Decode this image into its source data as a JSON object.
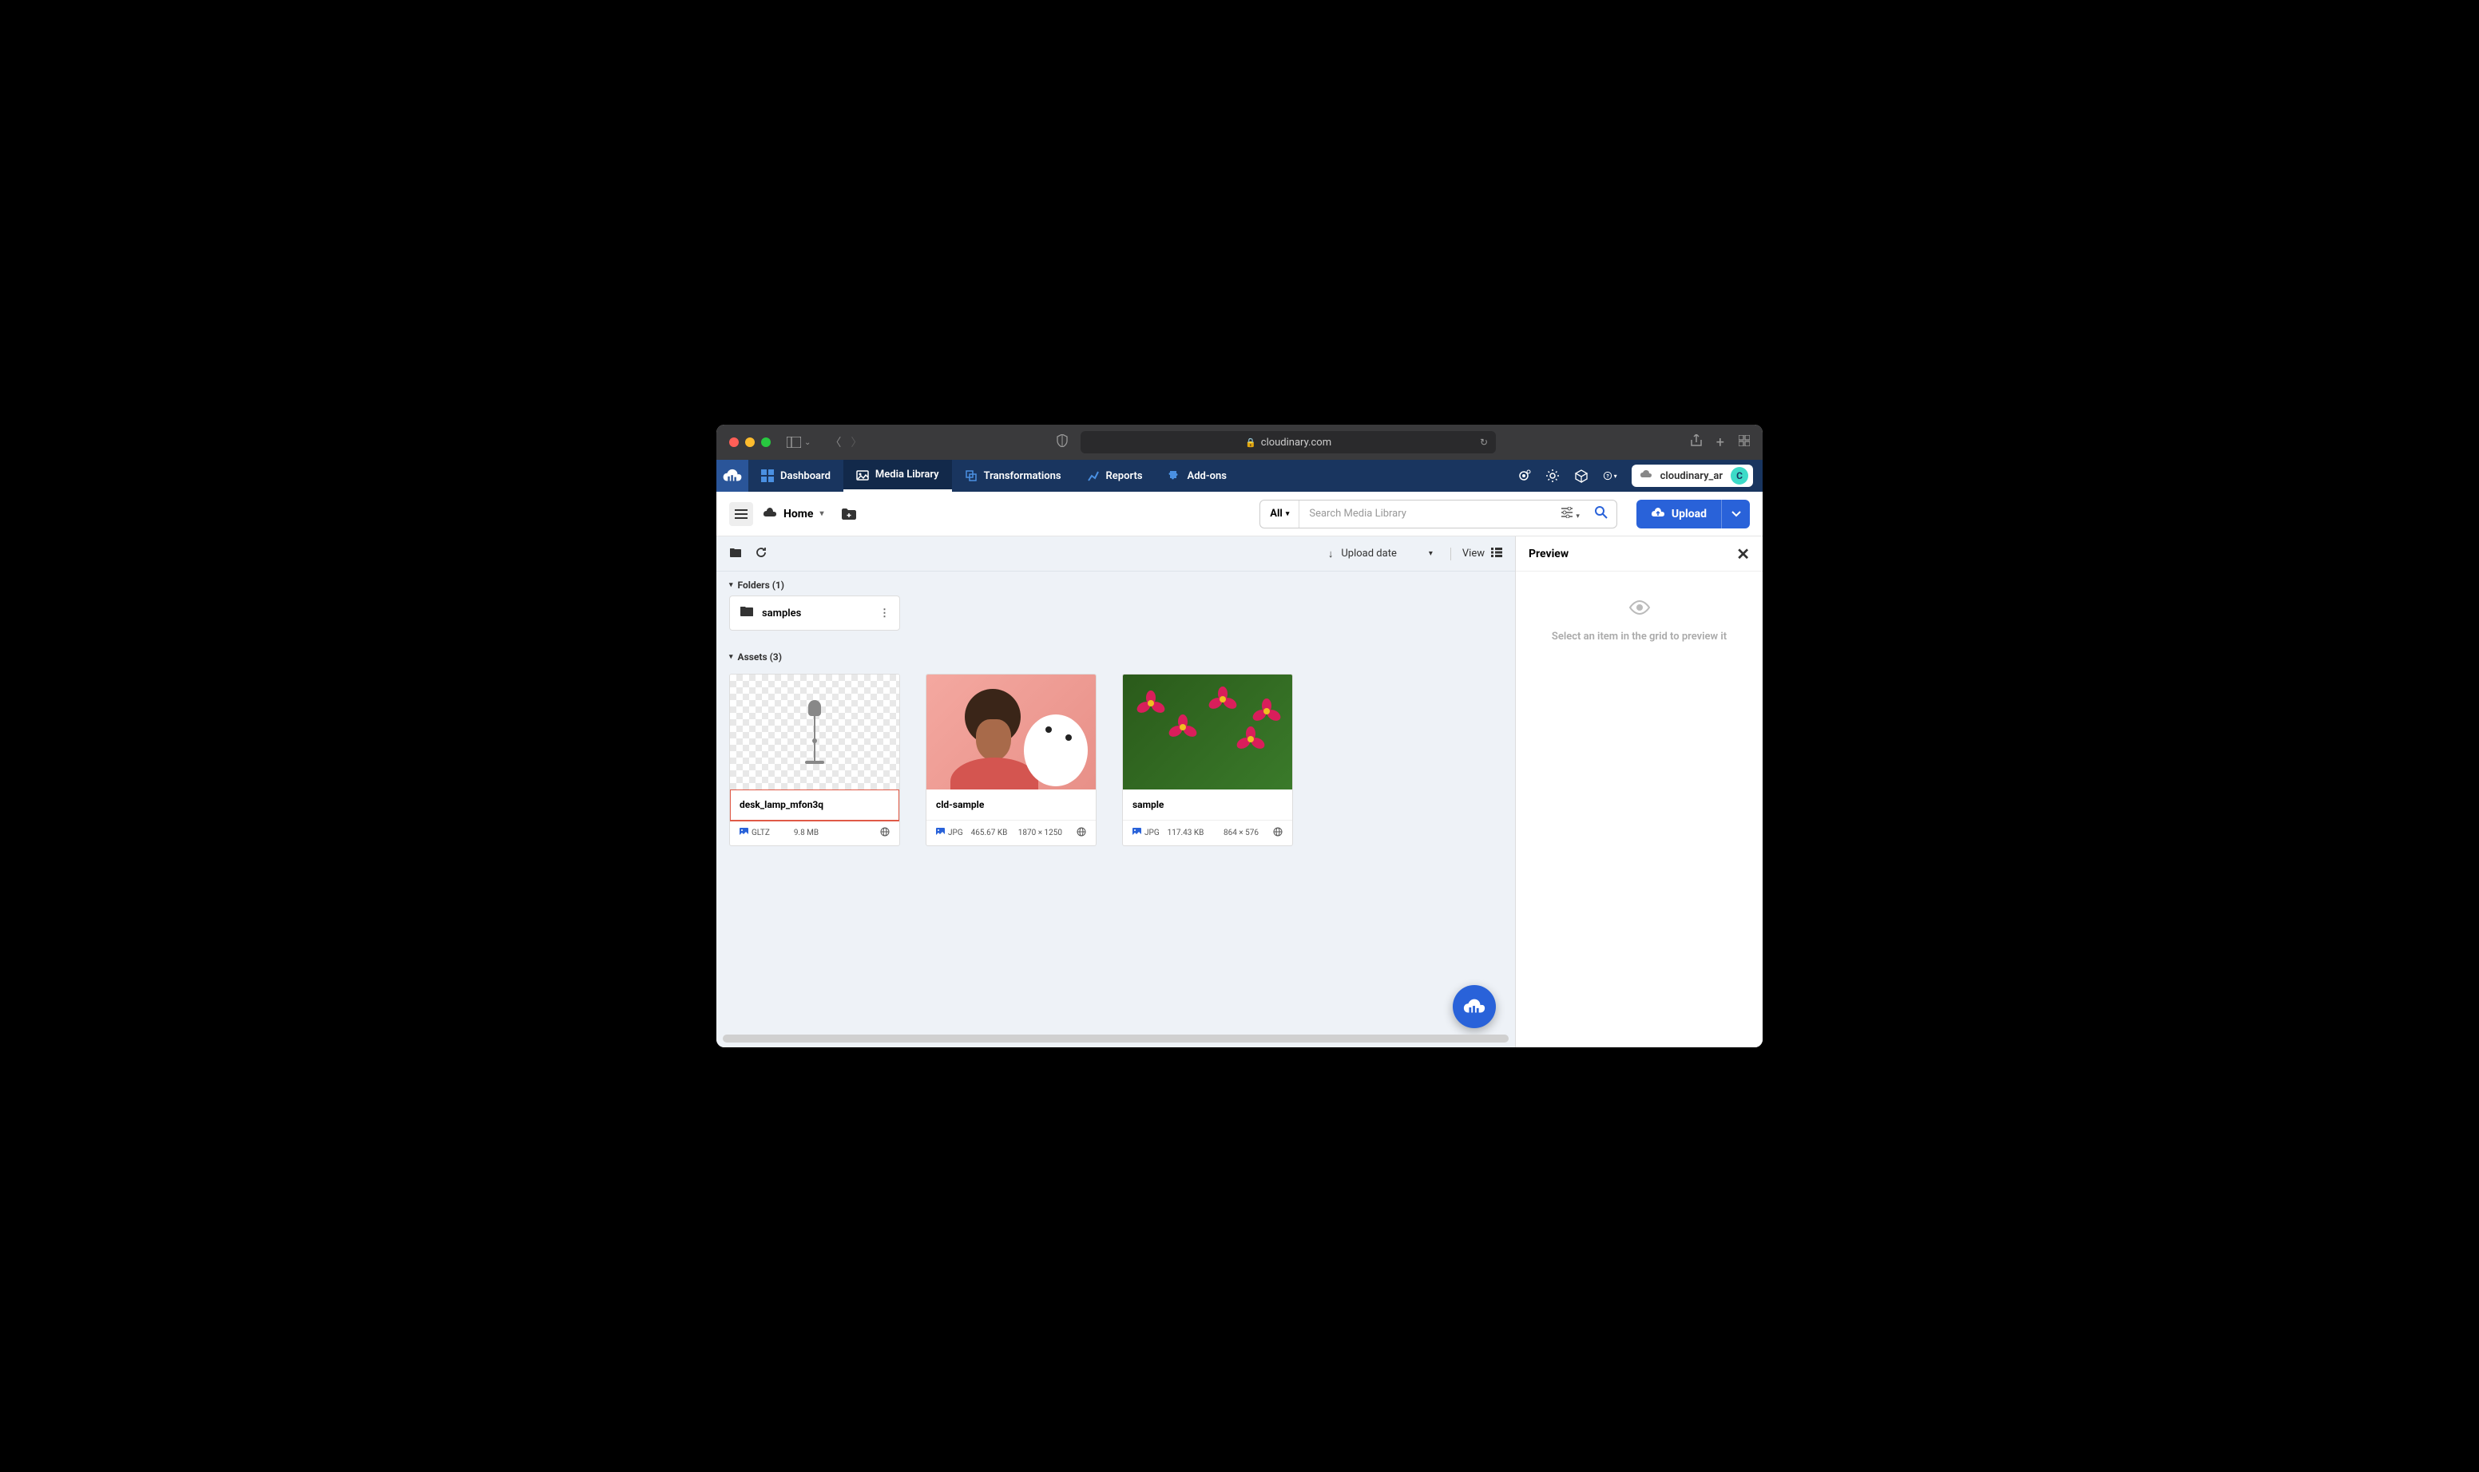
{
  "browser": {
    "url": "cloudinary.com"
  },
  "nav": {
    "items": [
      {
        "label": "Dashboard"
      },
      {
        "label": "Media Library"
      },
      {
        "label": "Transformations"
      },
      {
        "label": "Reports"
      },
      {
        "label": "Add-ons"
      }
    ],
    "account_name": "cloudinary_ar",
    "avatar_initial": "C"
  },
  "toolbar": {
    "breadcrumb": "Home",
    "search_filter": "All",
    "search_placeholder": "Search Media Library",
    "upload_label": "Upload"
  },
  "actionbar": {
    "sort_label": "Upload date",
    "view_label": "View"
  },
  "sections": {
    "folders_label": "Folders (1)",
    "assets_label": "Assets (3)"
  },
  "folders": [
    {
      "name": "samples"
    }
  ],
  "assets": [
    {
      "name": "desk_lamp_mfon3q",
      "format": "GLTZ",
      "size": "9.8 MB",
      "dimensions": "",
      "highlight": true
    },
    {
      "name": "cld-sample",
      "format": "JPG",
      "size": "465.67 KB",
      "dimensions": "1870 × 1250",
      "highlight": false
    },
    {
      "name": "sample",
      "format": "JPG",
      "size": "117.43 KB",
      "dimensions": "864 × 576",
      "highlight": false
    }
  ],
  "preview": {
    "title": "Preview",
    "empty_message": "Select an item in the grid to preview it"
  }
}
